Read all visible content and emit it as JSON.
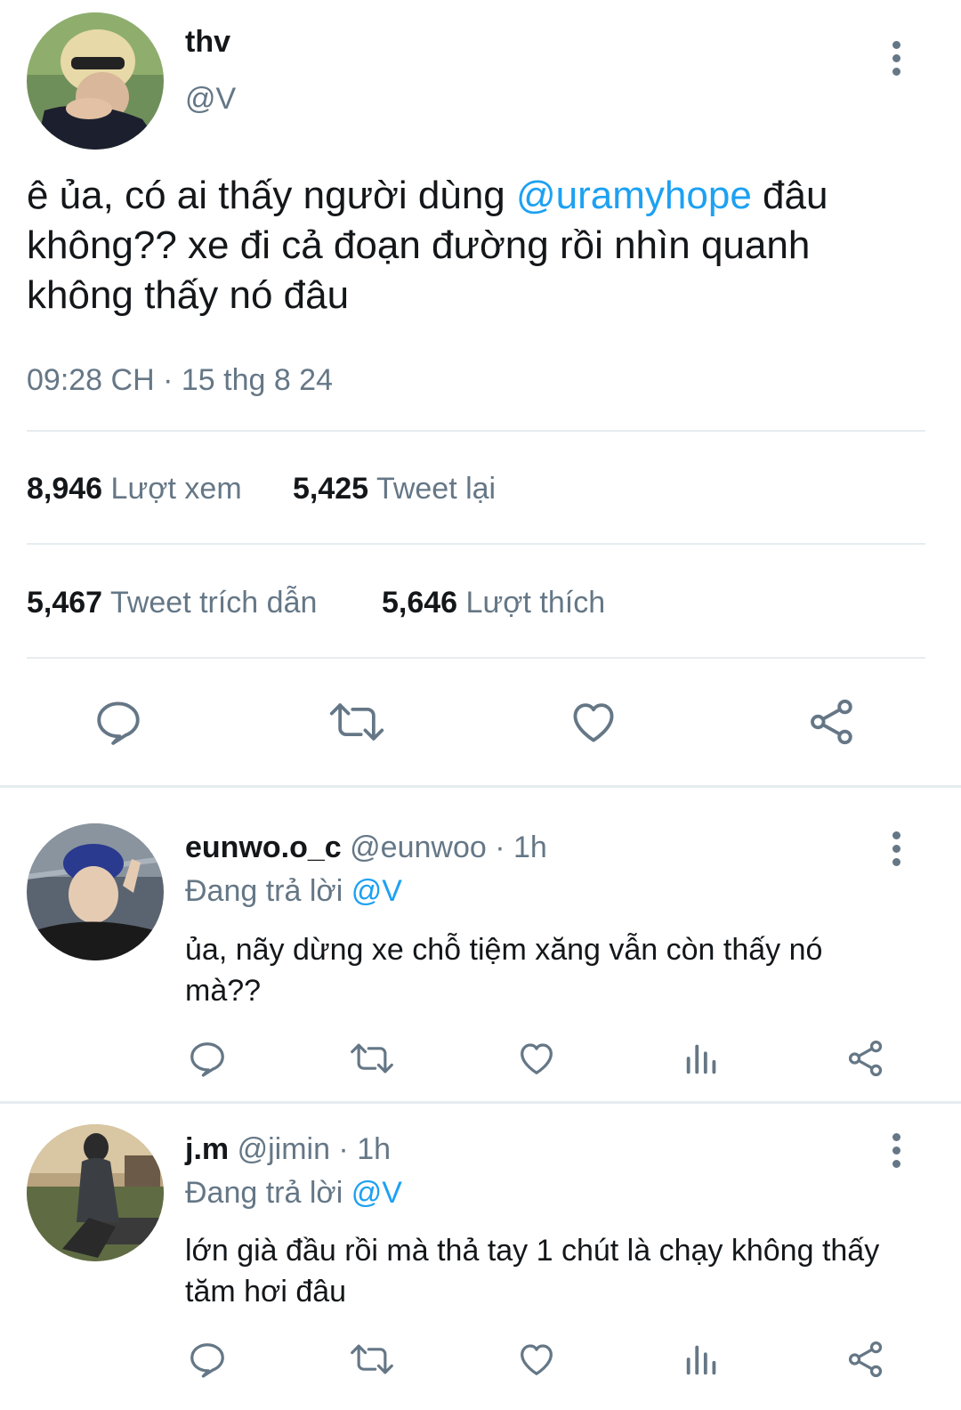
{
  "tweet": {
    "display_name": "thv",
    "handle": "@V",
    "text_before": "ê ủa, có ai thấy người dùng ",
    "mention": "@uramyhope",
    "text_after": " đâu không?? xe đi cả đoạn đường rồi nhìn quanh không thấy nó đâu",
    "timestamp": "09:28 CH · 15 thg 8 24",
    "stats": {
      "views_count": "8,946",
      "views_label": "Lượt xem",
      "retweets_count": "5,425",
      "retweets_label": "Tweet lại",
      "quotes_count": "5,467",
      "quotes_label": "Tweet trích dẫn",
      "likes_count": "5,646",
      "likes_label": "Lượt thích"
    }
  },
  "replies": [
    {
      "display_name": "eunwo.o_c",
      "handle_time": "@eunwoo · 1h",
      "replying_prefix": "Đang trả lời",
      "replying_to": "@V",
      "text": "ủa, nãy dừng xe chỗ tiệm xăng vẫn còn thấy nó mà??"
    },
    {
      "display_name": "j.m",
      "handle_time": "@jimin · 1h",
      "replying_prefix": "Đang trả lời",
      "replying_to": "@V",
      "text": "lớn già đầu rồi mà thả tay 1 chút là chạy không thấy tăm hơi đâu"
    }
  ],
  "icons": [
    "reply-icon",
    "retweet-icon",
    "like-icon",
    "share-icon",
    "analytics-icon",
    "more-icon"
  ],
  "colors": {
    "accent": "#1da1f2",
    "secondary_text": "#657786",
    "divider": "#e6ecf0"
  }
}
